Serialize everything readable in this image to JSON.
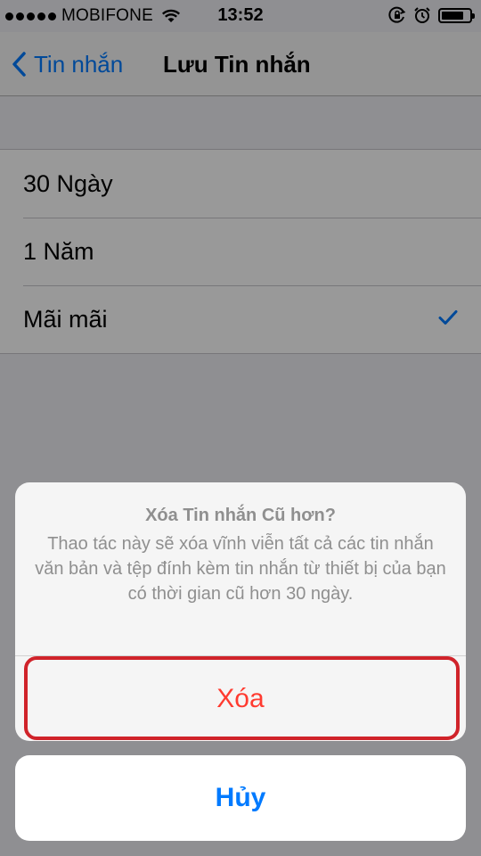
{
  "status_bar": {
    "carrier": "MOBIFONE",
    "time": "13:52",
    "battery_level": 0.8,
    "icons": [
      "signal-dots-icon",
      "wifi-icon",
      "orientation-lock-icon",
      "alarm-icon",
      "battery-icon"
    ]
  },
  "nav": {
    "back_label": "Tin nhắn",
    "title": "Lưu Tin nhắn"
  },
  "options": [
    {
      "label": "30 Ngày",
      "selected": false
    },
    {
      "label": "1 Năm",
      "selected": false
    },
    {
      "label": "Mãi mãi",
      "selected": true
    }
  ],
  "action_sheet": {
    "title": "Xóa Tin nhắn Cũ hơn?",
    "message": "Thao tác này sẽ xóa vĩnh viễn tất cả các tin nhắn văn bản và tệp đính kèm tin nhắn từ thiết bị của bạn có thời gian cũ hơn 30 ngày.",
    "destructive_label": "Xóa",
    "cancel_label": "Hủy"
  },
  "colors": {
    "accent": "#007aff",
    "destructive": "#ff3b30",
    "highlight_box": "#d0232a"
  }
}
